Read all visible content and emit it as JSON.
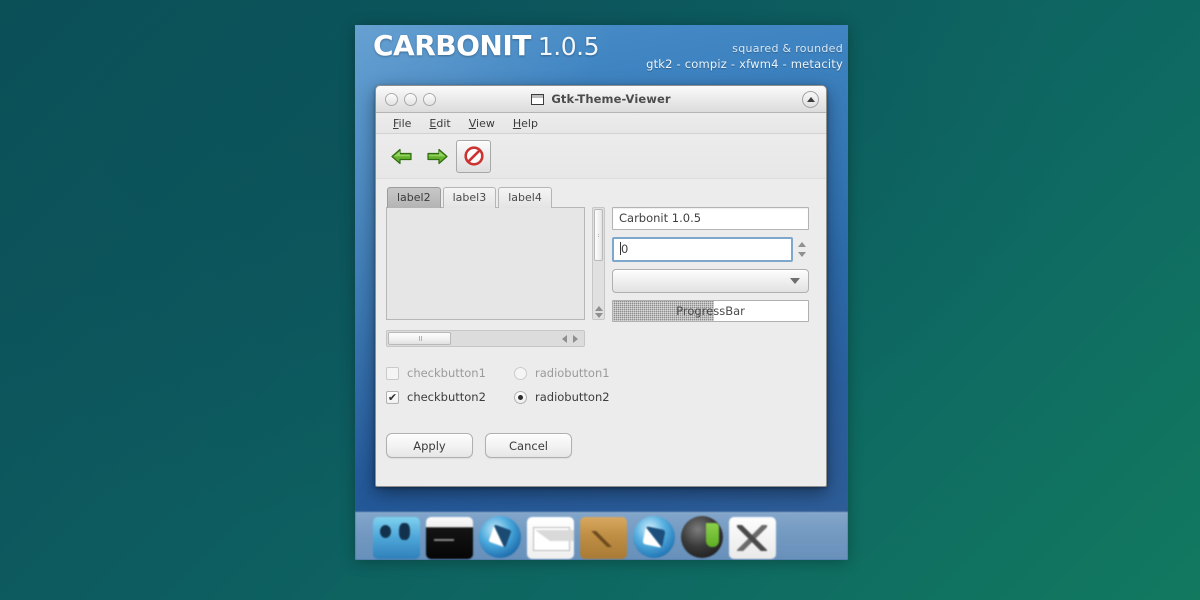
{
  "banner": {
    "brand": "CARBONIT",
    "version": "1.0.5",
    "tagline_1": "squared & rounded",
    "tagline_2": "gtk2 - compiz - xfwm4 - metacity"
  },
  "window": {
    "title": "Gtk-Theme-Viewer",
    "titlebar_buttons": [
      "close-button",
      "minimize-button",
      "maximize-button"
    ],
    "shade_button": "shade-button"
  },
  "menubar": {
    "items": [
      {
        "mnemonic": "F",
        "rest": "ile",
        "label": "File"
      },
      {
        "mnemonic": "E",
        "rest": "dit",
        "label": "Edit"
      },
      {
        "mnemonic": "V",
        "rest": "iew",
        "label": "View"
      },
      {
        "mnemonic": "H",
        "rest": "elp",
        "label": "Help"
      }
    ]
  },
  "toolbar": {
    "items": [
      {
        "name": "back-arrow-icon",
        "state": "normal"
      },
      {
        "name": "forward-arrow-icon",
        "state": "normal"
      },
      {
        "name": "stop-icon",
        "state": "active"
      }
    ]
  },
  "notebook": {
    "tabs": [
      {
        "label": "label2",
        "selected": true
      },
      {
        "label": "label3",
        "selected": false
      },
      {
        "label": "label4",
        "selected": false
      }
    ]
  },
  "fields": {
    "entry_value": "Carbonit 1.0.5",
    "spin_value": "0",
    "combo_value": "",
    "progress_label": "ProgressBar",
    "progress_percent": 52
  },
  "toggles": {
    "checkbutton1": {
      "label": "checkbutton1",
      "checked": false,
      "disabled": true
    },
    "checkbutton2": {
      "label": "checkbutton2",
      "checked": true,
      "disabled": false
    },
    "radiobutton1": {
      "label": "radiobutton1",
      "selected": false,
      "disabled": true
    },
    "radiobutton2": {
      "label": "radiobutton2",
      "selected": true,
      "disabled": false
    }
  },
  "buttons": {
    "apply": "Apply",
    "cancel": "Cancel"
  },
  "dock": {
    "icons": [
      "finder-icon",
      "terminal-icon",
      "safari-icon",
      "mail-icon",
      "wood-box-icon",
      "compass-icon",
      "itunes-icon",
      "utilities-icon"
    ]
  },
  "colors": {
    "desktop_teal": "#0d5a5f",
    "wallpaper_blue": "#2f6fae",
    "window_bg": "#ececec",
    "focus_blue": "#7ea7cc",
    "tab_selected": "#b4b4b4",
    "stop_red": "#cc3333",
    "arrow_green": "#5aa82e"
  }
}
